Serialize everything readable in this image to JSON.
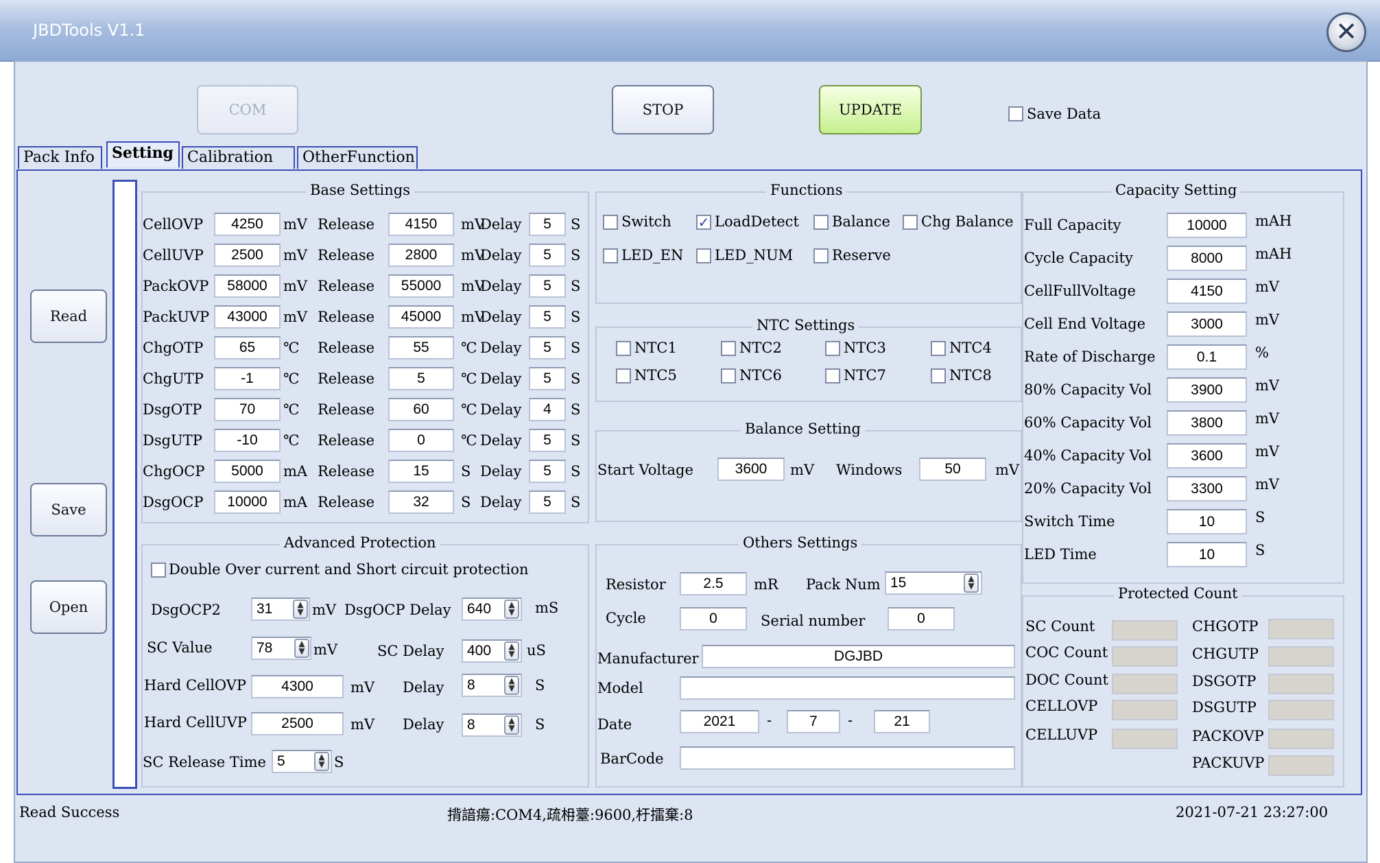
{
  "window": {
    "title": "JBDTools V1.1",
    "close_glyph": "✕"
  },
  "toolbar": {
    "com_label": "COM",
    "stop_label": "STOP",
    "update_label": "UPDATE",
    "save_data_label": "Save Data",
    "save_data_checked": false
  },
  "tabs": [
    {
      "label": "Pack Info",
      "active": false
    },
    {
      "label": "Setting",
      "active": true
    },
    {
      "label": "Calibration",
      "active": false
    },
    {
      "label": "OtherFunction",
      "active": false
    }
  ],
  "side_buttons": {
    "read": "Read",
    "save": "Save",
    "open": "Open"
  },
  "base_settings": {
    "title": "Base Settings",
    "release_label": "Release",
    "delay_label": "Delay",
    "rows": [
      {
        "name": "CellOVP",
        "value": "4250",
        "unit": "mV",
        "release": "4150",
        "release_unit": "mV",
        "delay": "5",
        "delay_unit": "S"
      },
      {
        "name": "CellUVP",
        "value": "2500",
        "unit": "mV",
        "release": "2800",
        "release_unit": "mV",
        "delay": "5",
        "delay_unit": "S"
      },
      {
        "name": "PackOVP",
        "value": "58000",
        "unit": "mV",
        "release": "55000",
        "release_unit": "mV",
        "delay": "5",
        "delay_unit": "S"
      },
      {
        "name": "PackUVP",
        "value": "43000",
        "unit": "mV",
        "release": "45000",
        "release_unit": "mV",
        "delay": "5",
        "delay_unit": "S"
      },
      {
        "name": "ChgOTP",
        "value": "65",
        "unit": "℃",
        "release": "55",
        "release_unit": "℃",
        "delay": "5",
        "delay_unit": "S"
      },
      {
        "name": "ChgUTP",
        "value": "-1",
        "unit": "℃",
        "release": "5",
        "release_unit": "℃",
        "delay": "5",
        "delay_unit": "S"
      },
      {
        "name": "DsgOTP",
        "value": "70",
        "unit": "℃",
        "release": "60",
        "release_unit": "℃",
        "delay": "4",
        "delay_unit": "S"
      },
      {
        "name": "DsgUTP",
        "value": "-10",
        "unit": "℃",
        "release": "0",
        "release_unit": "℃",
        "delay": "5",
        "delay_unit": "S"
      },
      {
        "name": "ChgOCP",
        "value": "5000",
        "unit": "mA",
        "release": "15",
        "release_unit": "S",
        "delay": "5",
        "delay_unit": "S"
      },
      {
        "name": "DsgOCP",
        "value": "10000",
        "unit": "mA",
        "release": "32",
        "release_unit": "S",
        "delay": "5",
        "delay_unit": "S"
      }
    ]
  },
  "functions": {
    "title": "Functions",
    "items": [
      {
        "label": "Switch",
        "checked": false
      },
      {
        "label": "LoadDetect",
        "checked": true
      },
      {
        "label": "Balance",
        "checked": false
      },
      {
        "label": "Chg Balance",
        "checked": false
      },
      {
        "label": "LED_EN",
        "checked": false
      },
      {
        "label": "LED_NUM",
        "checked": false
      },
      {
        "label": "Reserve",
        "checked": false
      }
    ]
  },
  "ntc_settings": {
    "title": "NTC Settings",
    "items": [
      {
        "label": "NTC1",
        "checked": false
      },
      {
        "label": "NTC2",
        "checked": false
      },
      {
        "label": "NTC3",
        "checked": false
      },
      {
        "label": "NTC4",
        "checked": false
      },
      {
        "label": "NTC5",
        "checked": false
      },
      {
        "label": "NTC6",
        "checked": false
      },
      {
        "label": "NTC7",
        "checked": false
      },
      {
        "label": "NTC8",
        "checked": false
      }
    ]
  },
  "balance_setting": {
    "title": "Balance Setting",
    "start_voltage_label": "Start Voltage",
    "start_voltage": "3600",
    "start_voltage_unit": "mV",
    "windows_label": "Windows",
    "windows": "50",
    "windows_unit": "mV"
  },
  "capacity_setting": {
    "title": "Capacity Setting",
    "rows": [
      {
        "label": "Full Capacity",
        "value": "10000",
        "unit": "mAH"
      },
      {
        "label": "Cycle Capacity",
        "value": "8000",
        "unit": "mAH"
      },
      {
        "label": "CellFullVoltage",
        "value": "4150",
        "unit": "mV"
      },
      {
        "label": "Cell End Voltage",
        "value": "3000",
        "unit": "mV"
      },
      {
        "label": "Rate of Discharge",
        "value": "0.1",
        "unit": "%"
      },
      {
        "label": "80% Capacity Vol",
        "value": "3900",
        "unit": "mV"
      },
      {
        "label": "60% Capacity Vol",
        "value": "3800",
        "unit": "mV"
      },
      {
        "label": "40% Capacity Vol",
        "value": "3600",
        "unit": "mV"
      },
      {
        "label": "20% Capacity Vol",
        "value": "3300",
        "unit": "mV"
      },
      {
        "label": "Switch Time",
        "value": "10",
        "unit": "S"
      },
      {
        "label": "LED Time",
        "value": "10",
        "unit": "S"
      }
    ]
  },
  "advanced_protection": {
    "title": "Advanced Protection",
    "double_ocp_label": "Double Over current and Short circuit protection",
    "double_ocp_checked": false,
    "dsgocp2_label": "DsgOCP2",
    "dsgocp2": "31",
    "dsgocp2_unit": "mV",
    "dsgocp_delay_label": "DsgOCP Delay",
    "dsgocp_delay": "640",
    "dsgocp_delay_unit": "mS",
    "sc_value_label": "SC Value",
    "sc_value": "78",
    "sc_value_unit": "mV",
    "sc_delay_label": "SC Delay",
    "sc_delay": "400",
    "sc_delay_unit": "uS",
    "hard_ovp_label": "Hard CellOVP",
    "hard_ovp": "4300",
    "hard_ovp_unit": "mV",
    "hard_ovp_delay_label": "Delay",
    "hard_ovp_delay": "8",
    "hard_ovp_delay_unit": "S",
    "hard_uvp_label": "Hard CellUVP",
    "hard_uvp": "2500",
    "hard_uvp_unit": "mV",
    "hard_uvp_delay_label": "Delay",
    "hard_uvp_delay": "8",
    "hard_uvp_delay_unit": "S",
    "sc_release_label": "SC Release Time",
    "sc_release": "5",
    "sc_release_unit": "S"
  },
  "others_settings": {
    "title": "Others Settings",
    "resistor_label": "Resistor",
    "resistor": "2.5",
    "resistor_unit": "mR",
    "pack_num_label": "Pack Num",
    "pack_num": "15",
    "cycle_label": "Cycle",
    "cycle": "0",
    "serial_label": "Serial number",
    "serial": "0",
    "manufacturer_label": "Manufacturer",
    "manufacturer": "DGJBD",
    "model_label": "Model",
    "model": "",
    "date_label": "Date",
    "date_year": "2021",
    "date_month": "7",
    "date_day": "21",
    "date_sep": "-",
    "barcode_label": "BarCode",
    "barcode": ""
  },
  "protected_count": {
    "title": "Protected Count",
    "left": [
      "SC Count",
      "COC Count",
      "DOC Count",
      "CELLOVP",
      "CELLUVP"
    ],
    "right": [
      "CHGOTP",
      "CHGUTP",
      "DSGOTP",
      "DSGUTP",
      "PACKOVP",
      "PACKUVP"
    ]
  },
  "status_bar": {
    "message": "Read Success",
    "port_info": "揹諳瘍:COM4,疏枏薹:9600,杅擂棄:8",
    "datetime": "2021-07-21 23:27:00"
  }
}
